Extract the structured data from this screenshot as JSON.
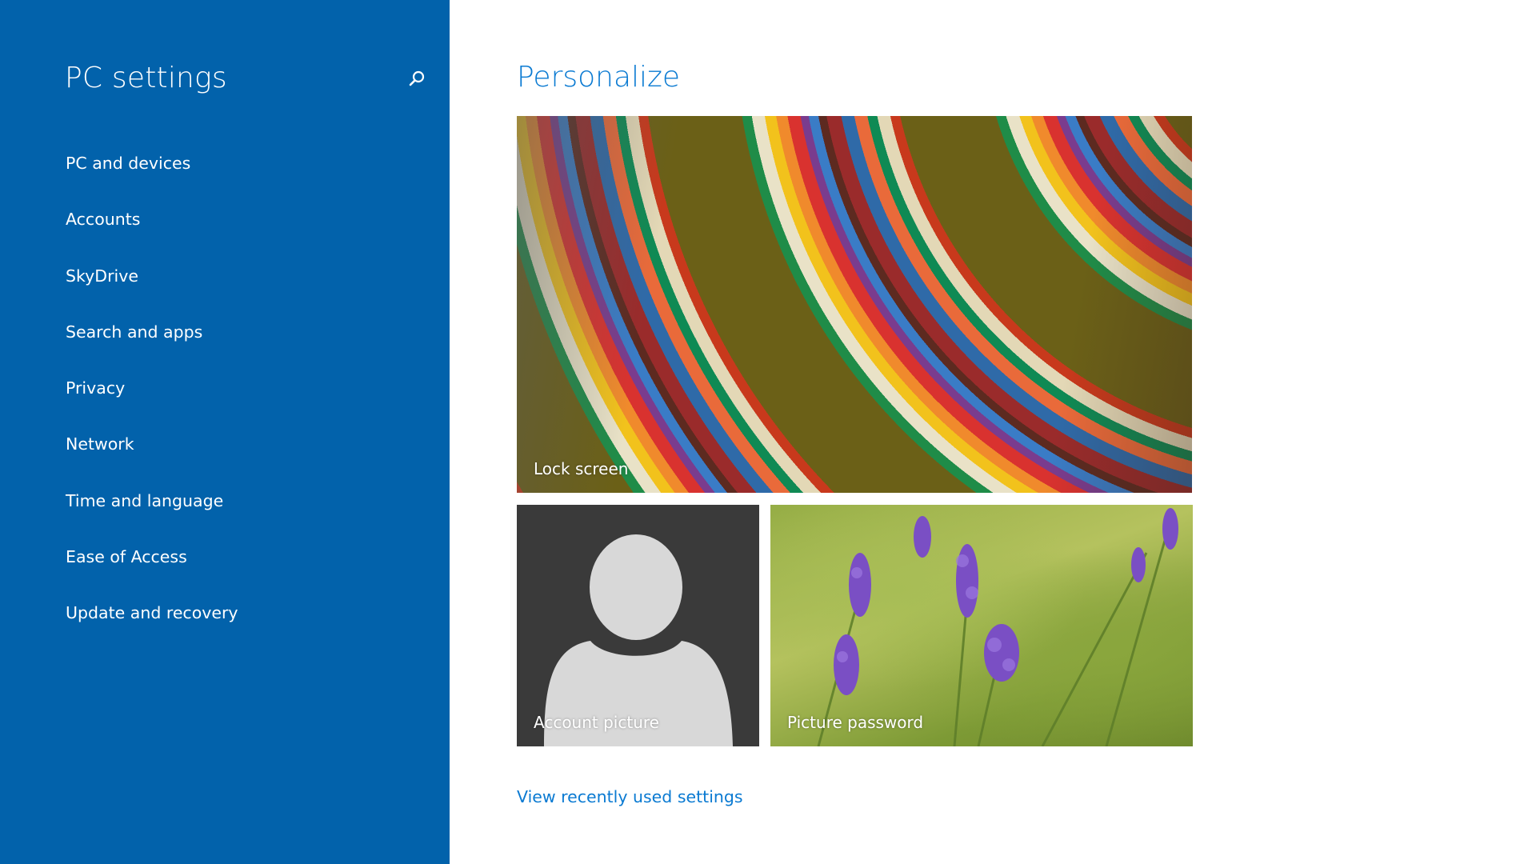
{
  "sidebar": {
    "title": "PC settings",
    "search_icon": "search-icon",
    "items": [
      {
        "label": "PC and devices"
      },
      {
        "label": "Accounts"
      },
      {
        "label": "SkyDrive"
      },
      {
        "label": "Search and apps"
      },
      {
        "label": "Privacy"
      },
      {
        "label": "Network"
      },
      {
        "label": "Time and language"
      },
      {
        "label": "Ease of Access"
      },
      {
        "label": "Update and recovery"
      }
    ]
  },
  "main": {
    "title": "Personalize",
    "tiles": {
      "lock_screen": {
        "label": "Lock screen"
      },
      "account_picture": {
        "label": "Account picture"
      },
      "picture_password": {
        "label": "Picture password"
      }
    },
    "recent_link": "View recently used settings"
  },
  "colors": {
    "sidebar_bg": "#0262ab",
    "accent": "#0a7ad2",
    "account_tile_bg": "#3a3a3a",
    "avatar_silhouette": "#d8d8d8"
  }
}
